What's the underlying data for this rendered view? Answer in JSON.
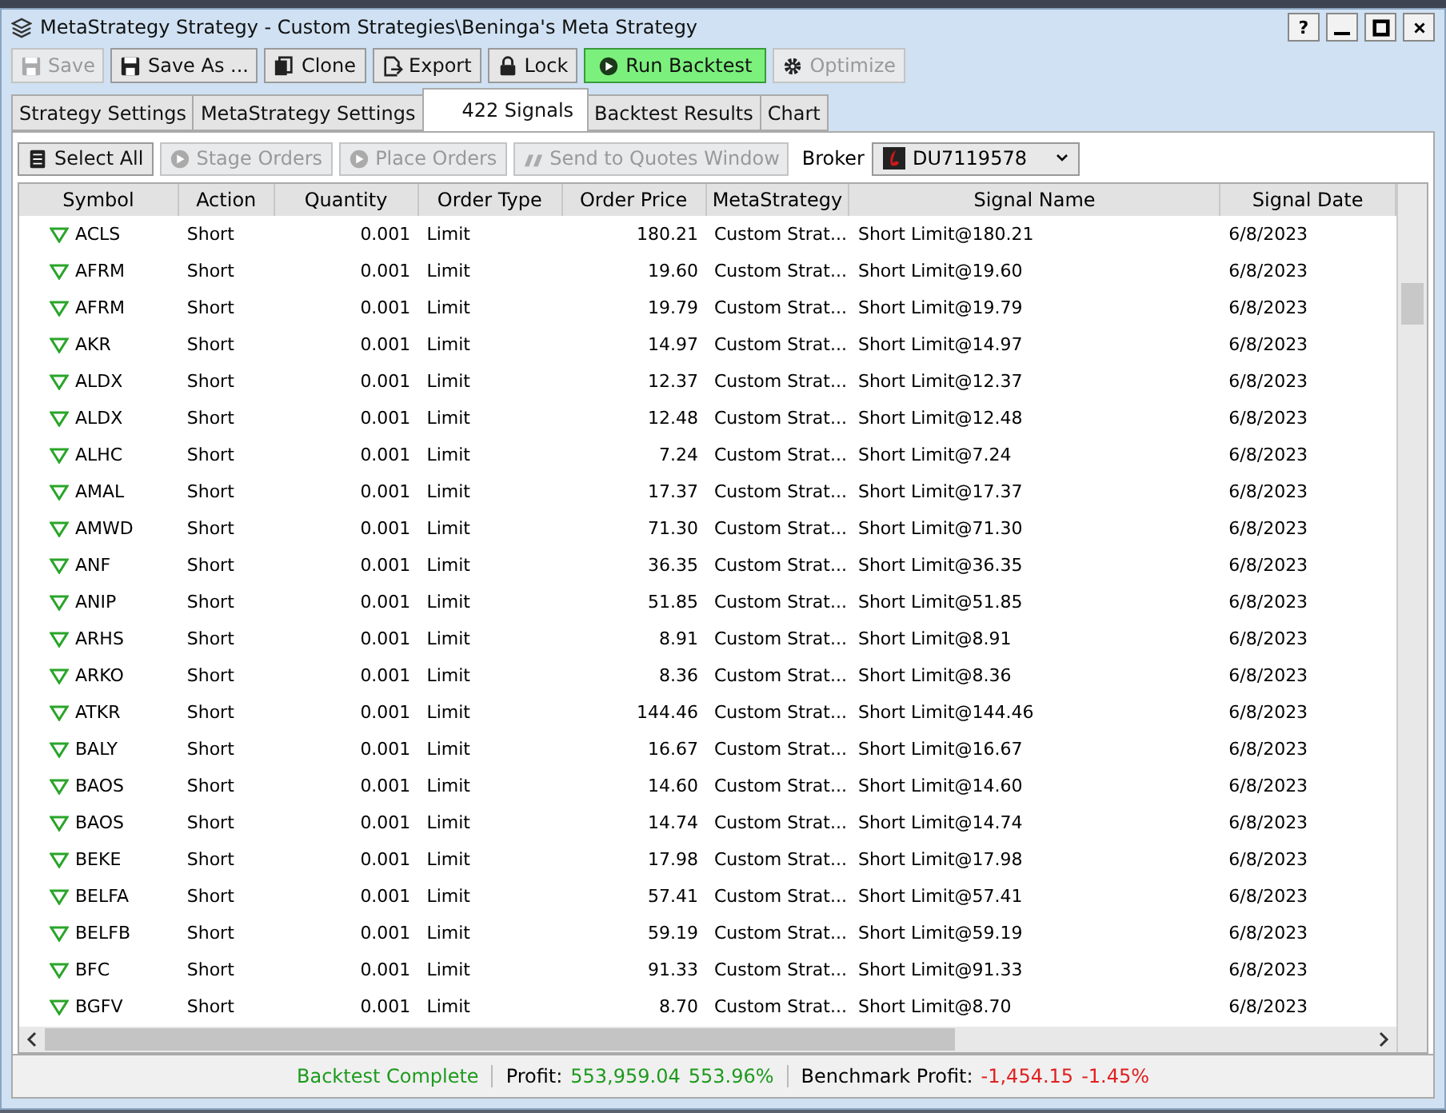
{
  "window": {
    "title": "MetaStrategy Strategy - Custom Strategies\\Beninga's Meta Strategy",
    "controls": [
      "?"
    ]
  },
  "toolbar": [
    {
      "label": "Save",
      "kind": "disk",
      "disabled": true
    },
    {
      "label": "Save As ...",
      "kind": "disk",
      "disabled": false
    },
    {
      "label": "Clone",
      "kind": "clone",
      "disabled": false
    },
    {
      "label": "Export",
      "kind": "export",
      "disabled": false
    },
    {
      "label": "Lock",
      "kind": "lock",
      "disabled": false
    },
    {
      "label": "Run Backtest",
      "kind": "play",
      "disabled": false,
      "primary": true
    },
    {
      "label": "Optimize",
      "kind": "gear",
      "disabled": true
    }
  ],
  "tabs": [
    {
      "label": "Strategy Settings",
      "selected": false
    },
    {
      "label": "MetaStrategy Settings",
      "selected": false
    },
    {
      "label": "422 Signals",
      "selected": true
    },
    {
      "label": "Backtest Results",
      "selected": false
    },
    {
      "label": "Chart",
      "selected": false
    }
  ],
  "signal_toolbar": {
    "buttons": [
      {
        "label": "Select All",
        "kind": "list",
        "disabled": false
      },
      {
        "label": "Stage Orders",
        "kind": "play",
        "disabled": true
      },
      {
        "label": "Place Orders",
        "kind": "play",
        "disabled": true
      },
      {
        "label": "Send to Quotes Window",
        "kind": "quotes",
        "disabled": true
      }
    ],
    "broker_label": "Broker",
    "broker_value": "DU7119578"
  },
  "table": {
    "columns": [
      "Symbol",
      "Action",
      "Quantity",
      "Order Type",
      "Order Price",
      "MetaStrategy",
      "Signal Name",
      "Signal Date"
    ],
    "rows": [
      [
        "ACLS",
        "Short",
        "0.001",
        "Limit",
        "180.21",
        "Custom Strat...",
        "Short Limit@180.21",
        "6/8/2023"
      ],
      [
        "AFRM",
        "Short",
        "0.001",
        "Limit",
        "19.60",
        "Custom Strat...",
        "Short Limit@19.60",
        "6/8/2023"
      ],
      [
        "AFRM",
        "Short",
        "0.001",
        "Limit",
        "19.79",
        "Custom Strat...",
        "Short Limit@19.79",
        "6/8/2023"
      ],
      [
        "AKR",
        "Short",
        "0.001",
        "Limit",
        "14.97",
        "Custom Strat...",
        "Short Limit@14.97",
        "6/8/2023"
      ],
      [
        "ALDX",
        "Short",
        "0.001",
        "Limit",
        "12.37",
        "Custom Strat...",
        "Short Limit@12.37",
        "6/8/2023"
      ],
      [
        "ALDX",
        "Short",
        "0.001",
        "Limit",
        "12.48",
        "Custom Strat...",
        "Short Limit@12.48",
        "6/8/2023"
      ],
      [
        "ALHC",
        "Short",
        "0.001",
        "Limit",
        "7.24",
        "Custom Strat...",
        "Short Limit@7.24",
        "6/8/2023"
      ],
      [
        "AMAL",
        "Short",
        "0.001",
        "Limit",
        "17.37",
        "Custom Strat...",
        "Short Limit@17.37",
        "6/8/2023"
      ],
      [
        "AMWD",
        "Short",
        "0.001",
        "Limit",
        "71.30",
        "Custom Strat...",
        "Short Limit@71.30",
        "6/8/2023"
      ],
      [
        "ANF",
        "Short",
        "0.001",
        "Limit",
        "36.35",
        "Custom Strat...",
        "Short Limit@36.35",
        "6/8/2023"
      ],
      [
        "ANIP",
        "Short",
        "0.001",
        "Limit",
        "51.85",
        "Custom Strat...",
        "Short Limit@51.85",
        "6/8/2023"
      ],
      [
        "ARHS",
        "Short",
        "0.001",
        "Limit",
        "8.91",
        "Custom Strat...",
        "Short Limit@8.91",
        "6/8/2023"
      ],
      [
        "ARKO",
        "Short",
        "0.001",
        "Limit",
        "8.36",
        "Custom Strat...",
        "Short Limit@8.36",
        "6/8/2023"
      ],
      [
        "ATKR",
        "Short",
        "0.001",
        "Limit",
        "144.46",
        "Custom Strat...",
        "Short Limit@144.46",
        "6/8/2023"
      ],
      [
        "BALY",
        "Short",
        "0.001",
        "Limit",
        "16.67",
        "Custom Strat...",
        "Short Limit@16.67",
        "6/8/2023"
      ],
      [
        "BAOS",
        "Short",
        "0.001",
        "Limit",
        "14.60",
        "Custom Strat...",
        "Short Limit@14.60",
        "6/8/2023"
      ],
      [
        "BAOS",
        "Short",
        "0.001",
        "Limit",
        "14.74",
        "Custom Strat...",
        "Short Limit@14.74",
        "6/8/2023"
      ],
      [
        "BEKE",
        "Short",
        "0.001",
        "Limit",
        "17.98",
        "Custom Strat...",
        "Short Limit@17.98",
        "6/8/2023"
      ],
      [
        "BELFA",
        "Short",
        "0.001",
        "Limit",
        "57.41",
        "Custom Strat...",
        "Short Limit@57.41",
        "6/8/2023"
      ],
      [
        "BELFB",
        "Short",
        "0.001",
        "Limit",
        "59.19",
        "Custom Strat...",
        "Short Limit@59.19",
        "6/8/2023"
      ],
      [
        "BFC",
        "Short",
        "0.001",
        "Limit",
        "91.33",
        "Custom Strat...",
        "Short Limit@91.33",
        "6/8/2023"
      ],
      [
        "BGFV",
        "Short",
        "0.001",
        "Limit",
        "8.70",
        "Custom Strat...",
        "Short Limit@8.70",
        "6/8/2023"
      ]
    ]
  },
  "status_bar": [
    {
      "label": "Backtest Complete",
      "color": "#1d9a1d"
    },
    {
      "label": "Profit:",
      "values": [
        "553,959.04",
        "553.96%"
      ],
      "color": "#1d9a1d"
    },
    {
      "label": "Benchmark Profit:",
      "values": [
        "-1,454.15",
        "-1.45%"
      ],
      "color": "#e02020"
    }
  ]
}
